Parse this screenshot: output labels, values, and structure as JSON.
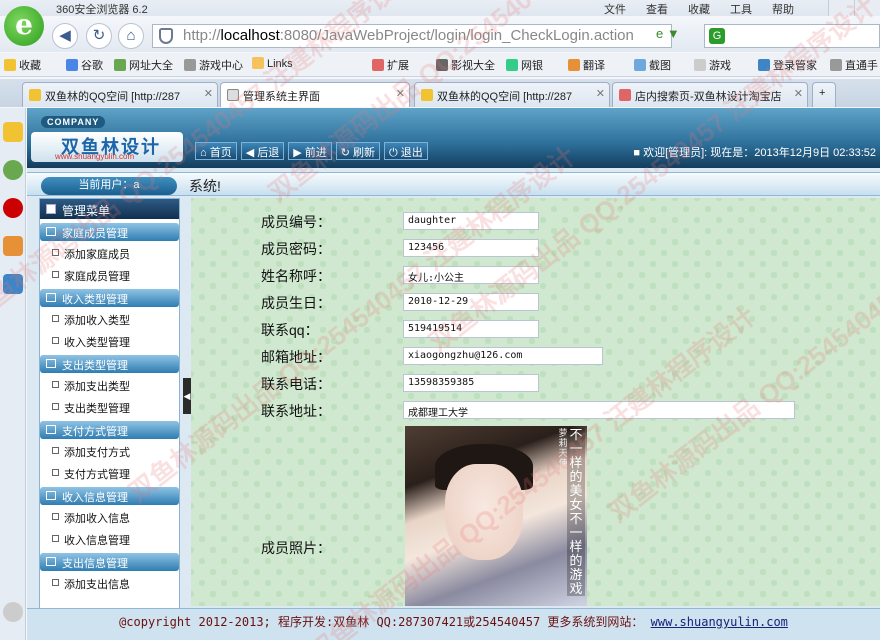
{
  "browser": {
    "title": "360安全浏览器 6.2",
    "menus": [
      "文件",
      "查看",
      "收藏",
      "工具",
      "帮助"
    ],
    "address_host": "localhost",
    "address_rest": ":8080/JavaWebProject/login/login_CheckLogin.action",
    "favorites": [
      "收藏",
      "谷歌",
      "网址大全",
      "游戏中心",
      "Links",
      "扩展",
      "影视大全",
      "网银",
      "翻译",
      "截图",
      "游戏",
      "登录管家",
      "直通手"
    ],
    "tabs": [
      "双鱼林的QQ空间 [http://287",
      "管理系统主界面",
      "双鱼林的QQ空间 [http://287",
      "店内搜索页-双鱼林设计淘宝店"
    ]
  },
  "site": {
    "company": "COMPANY",
    "logo_name": "双鱼林设计",
    "logo_url": "www.shuangyulin.com",
    "nav": [
      "首页",
      "后退",
      "前进",
      "刷新",
      "退出"
    ],
    "welcome": "■ 欢迎[管理员]: 现在是：2013年12月9日 02:33:52",
    "current_user": "当前用户：a",
    "system_label": "系统!"
  },
  "sidebar": {
    "title": "管理菜单",
    "groups": [
      {
        "head": "家庭成员管理",
        "items": [
          "添加家庭成员",
          "家庭成员管理"
        ]
      },
      {
        "head": "收入类型管理",
        "items": [
          "添加收入类型",
          "收入类型管理"
        ]
      },
      {
        "head": "支出类型管理",
        "items": [
          "添加支出类型",
          "支出类型管理"
        ]
      },
      {
        "head": "支付方式管理",
        "items": [
          "添加支付方式",
          "支付方式管理"
        ]
      },
      {
        "head": "收入信息管理",
        "items": [
          "添加收入信息",
          "收入信息管理"
        ]
      },
      {
        "head": "支出信息管理",
        "items": [
          "添加支出信息"
        ]
      }
    ]
  },
  "form": {
    "fields": [
      {
        "label": "成员编号：",
        "value": "daughter"
      },
      {
        "label": "成员密码：",
        "value": "123456"
      },
      {
        "label": "姓名称呼：",
        "value": "女儿:小公主"
      },
      {
        "label": "成员生日：",
        "value": "2010-12-29"
      },
      {
        "label": "联系qq：",
        "value": "519419514"
      },
      {
        "label": "邮箱地址：",
        "value": "xiaogongzhu@126.com"
      },
      {
        "label": "联系电话：",
        "value": "13598359385"
      },
      {
        "label": "联系地址：",
        "value": "成都理工大学"
      }
    ],
    "photo_label": "成员照片：",
    "photo_text": "不一样的美女 不一样的游戏",
    "photo_subtext": "萝莉天使"
  },
  "footer": {
    "text": "@copyright 2012-2013; 程序开发:双鱼林  QQ:287307421或254540457  更多系统到网站：",
    "link": "www.shuangyulin.com"
  },
  "watermark": "双鱼林源码出品 QQ:254540457 汪建林程序设计"
}
